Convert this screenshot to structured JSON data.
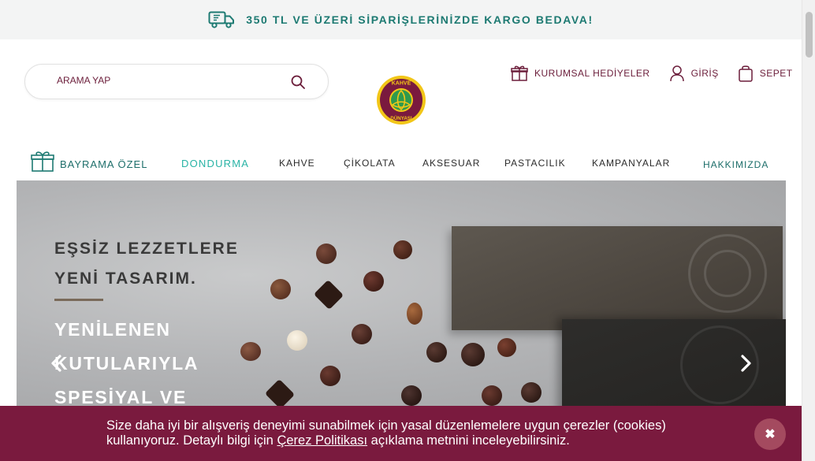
{
  "topbar": {
    "message": "350 TL VE ÜZERİ SİPARİŞLERİNİZDE KARGO BEDAVA!",
    "icon": "truck-icon"
  },
  "search": {
    "placeholder": "ARAMA YAP",
    "icon": "search-icon"
  },
  "logo": {
    "line1": "KAHVE",
    "line2": "DÜNYASI"
  },
  "header_actions": [
    {
      "label": "KURUMSAL HEDİYELER",
      "icon": "gift-icon"
    },
    {
      "label": "GİRİŞ",
      "icon": "user-icon"
    },
    {
      "label": "SEPET",
      "icon": "bag-icon"
    }
  ],
  "nav": {
    "special": "BAYRAMA ÖZEL",
    "items": [
      "DONDURMA",
      "KAHVE",
      "ÇİKOLATA",
      "AKSESUAR",
      "PASTACILIK",
      "KAMPANYALAR"
    ],
    "about": "HAKKIMIZDA"
  },
  "hero": {
    "line1": "EŞSİZ LEZZETLERE",
    "line2": "YENİ TASARIM.",
    "line3": "YENİLENEN",
    "line4": "KUTULARIYLA",
    "line5": "SPESİYAL VE"
  },
  "cookie": {
    "text_before": "Size daha iyi bir alışveriş deneyimi sunabilmek için yasal düzenlemelere uygun çerezler (cookies) kullanıyoruz. Detaylı bilgi için ",
    "link": "Çerez Politikası",
    "text_after": " açıklama metnini inceleyebilirsiniz.",
    "close": "✖"
  },
  "colors": {
    "brand": "#7a1a3e",
    "accent": "#28b3a5",
    "teal": "#1d7a72"
  }
}
